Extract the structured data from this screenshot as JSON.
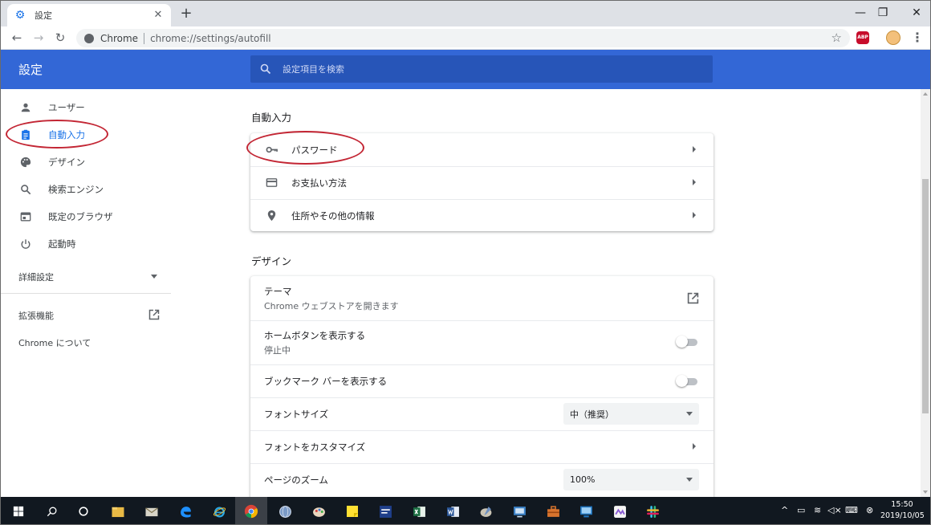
{
  "browser": {
    "tab_title": "設定",
    "tab_icon": "gear-icon",
    "origin_label": "Chrome",
    "url": "chrome://settings/autofill",
    "abp_label": "ABP"
  },
  "header": {
    "title": "設定",
    "search_placeholder": "設定項目を検索"
  },
  "sidebar": {
    "items": [
      {
        "label": "ユーザー",
        "icon": "person-icon"
      },
      {
        "label": "自動入力",
        "icon": "clipboard-icon"
      },
      {
        "label": "デザイン",
        "icon": "palette-icon"
      },
      {
        "label": "検索エンジン",
        "icon": "search-icon"
      },
      {
        "label": "既定のブラウザ",
        "icon": "browser-window-icon"
      },
      {
        "label": "起動時",
        "icon": "power-icon"
      }
    ],
    "advanced_label": "詳細設定",
    "extensions_label": "拡張機能",
    "about_label": "Chrome について"
  },
  "autofill_section": {
    "title": "自動入力",
    "rows": [
      {
        "label": "パスワード",
        "icon": "key-icon"
      },
      {
        "label": "お支払い方法",
        "icon": "credit-card-icon"
      },
      {
        "label": "住所やその他の情報",
        "icon": "location-pin-icon"
      }
    ]
  },
  "design_section": {
    "title": "デザイン",
    "theme": {
      "label": "テーマ",
      "sub": "Chrome ウェブストアを開きます"
    },
    "home_button": {
      "label": "ホームボタンを表示する",
      "sub": "停止中",
      "enabled": false
    },
    "bookmarks_bar": {
      "label": "ブックマーク バーを表示する",
      "enabled": false
    },
    "font_size": {
      "label": "フォントサイズ",
      "value": "中（推奨）"
    },
    "customize_fonts": {
      "label": "フォントをカスタマイズ"
    },
    "page_zoom": {
      "label": "ページのズーム",
      "value": "100%"
    }
  },
  "taskbar": {
    "time": "15:50",
    "date": "2019/10/05"
  },
  "colors": {
    "header_blue": "#3367d6",
    "accent": "#1a73e8",
    "annotation_red": "#c32634"
  }
}
